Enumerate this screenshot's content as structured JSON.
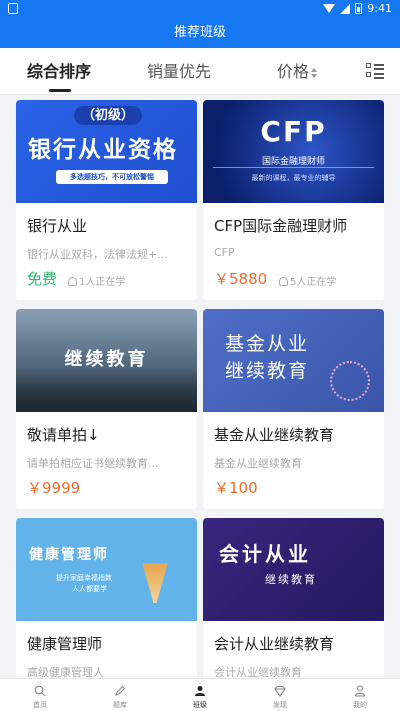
{
  "status_bar": {
    "time": "9:41"
  },
  "header": {
    "title": "推荐班级"
  },
  "sort_bar": {
    "items": [
      {
        "label": "综合排序"
      },
      {
        "label": "销量优先"
      },
      {
        "label": "价格"
      }
    ]
  },
  "courses": [
    {
      "banner": {
        "line1": "（初级）",
        "line2": "银行从业资格",
        "line3": "多选题技巧，不可放松警惕"
      },
      "title": "银行从业",
      "desc": "银行从业双科，法律法规+...",
      "price": "免费",
      "learners": "1人正在学"
    },
    {
      "banner": {
        "line1": "CFP",
        "line2": "国际金融理财师",
        "line3": "最新的课程，最专业的辅导"
      },
      "title": "CFP国际金融理财师",
      "desc": "CFP",
      "price": "￥5880",
      "learners": "5人正在学"
    },
    {
      "banner": {
        "line1": "继续教育"
      },
      "title": "敬请单拍↓",
      "desc": "请单拍相应证书继续教育...",
      "price": "￥9999"
    },
    {
      "banner": {
        "line1": "基金从业",
        "line2": "继续教育"
      },
      "title": "基金从业继续教育",
      "desc": "基金从业继续教育",
      "price": "￥100"
    },
    {
      "banner": {
        "line1": "健康管理师",
        "line2": "提升家庭幸福指数",
        "line3": "人人都要学"
      },
      "title": "健康管理师",
      "desc": "高级健康管理人"
    },
    {
      "banner": {
        "line1": "会计从业",
        "line2": "继续教育"
      },
      "title": "会计从业继续教育",
      "desc": "会计从业继续教育"
    }
  ],
  "tab_bar": {
    "items": [
      {
        "label": "首页",
        "icon": "search-icon"
      },
      {
        "label": "题库",
        "icon": "pencil-icon"
      },
      {
        "label": "班级",
        "icon": "class-icon"
      },
      {
        "label": "发现",
        "icon": "discover-icon"
      },
      {
        "label": "我的",
        "icon": "user-icon"
      }
    ],
    "active": "班级"
  },
  "colors": {
    "primary": "#1677f2",
    "price": "#f06a2a",
    "free": "#2fb86b"
  }
}
